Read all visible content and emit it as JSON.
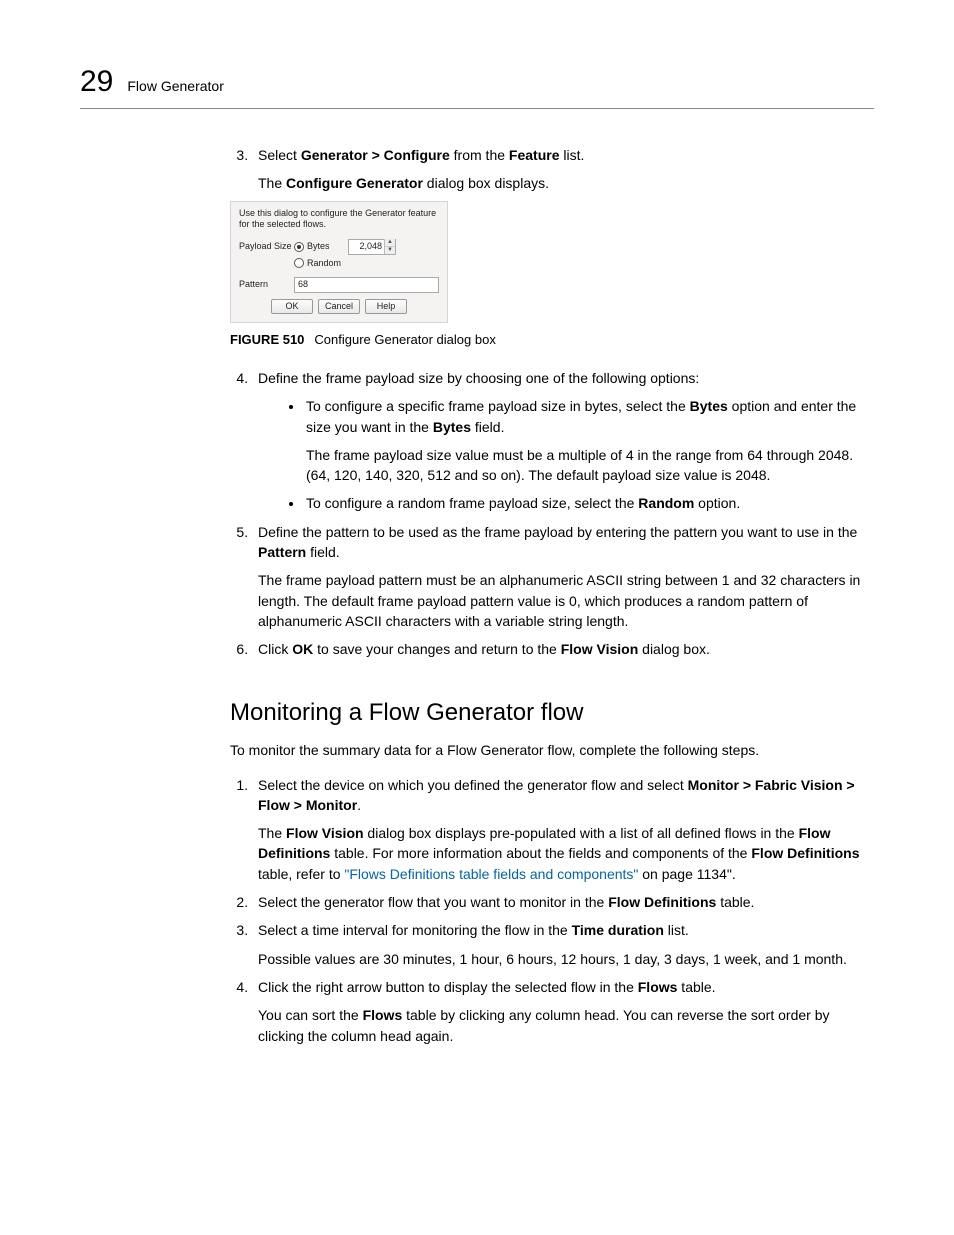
{
  "header": {
    "chapter_number": "29",
    "chapter_title": "Flow Generator"
  },
  "step3": {
    "num": "3.",
    "pre": "Select ",
    "menu": "Generator > Configure",
    "mid": " from the ",
    "feature": "Feature",
    "post": " list.",
    "sub_pre": "The ",
    "sub_bold": "Configure Generator",
    "sub_post": " dialog box displays."
  },
  "dialog": {
    "desc": "Use this dialog to configure the Generator feature for the selected flows.",
    "payload_label": "Payload Size",
    "bytes_label": "Bytes",
    "bytes_value": "2,048",
    "random_label": "Random",
    "pattern_label": "Pattern",
    "pattern_value": "68",
    "ok": "OK",
    "cancel": "Cancel",
    "help": "Help"
  },
  "figure": {
    "label": "FIGURE 510",
    "caption": "Configure Generator dialog box"
  },
  "step4": {
    "text": "Define the frame payload size by choosing one of the following options:",
    "b1_pre": "To configure a specific frame payload size in bytes, select the ",
    "b1_bytes": "Bytes",
    "b1_mid": " option and enter the size you want in the ",
    "b1_bytes2": "Bytes",
    "b1_post": " field.",
    "b1_para": "The frame payload size value must be a multiple of 4 in the range from 64 through 2048. (64, 120, 140, 320, 512 and so on). The default payload size value is 2048.",
    "b2_pre": "To configure a random frame payload size, select the ",
    "b2_random": "Random",
    "b2_post": " option."
  },
  "step5": {
    "pre": "Define the pattern to be used as the frame payload by entering the pattern you want to use in the ",
    "pattern": "Pattern",
    "post": " field.",
    "para": "The frame payload pattern must be an alphanumeric ASCII string between 1 and 32 characters in length. The default frame payload pattern value is 0, which produces a random pattern of alphanumeric ASCII characters with a variable string length."
  },
  "step6": {
    "pre": "Click ",
    "ok": "OK",
    "mid": " to save your changes and return to the ",
    "fv": "Flow Vision",
    "post": " dialog box."
  },
  "section2": {
    "heading": "Monitoring a Flow Generator flow",
    "intro": "To monitor the summary data for a Flow Generator flow, complete the following steps."
  },
  "m1": {
    "pre": "Select the device on which you defined the generator flow and select ",
    "menu": "Monitor > Fabric Vision > Flow > Monitor",
    "post": ".",
    "p_pre": "The ",
    "p_fv": "Flow Vision",
    "p_mid": " dialog box displays pre-populated with a list of all defined flows in the ",
    "p_fd1": "Flow Definitions",
    "p_mid2": " table. For more information about the fields and components of the ",
    "p_fd2": "Flow Definitions",
    "p_mid3": " table, refer to ",
    "p_link": "\"Flows Definitions table fields and components\"",
    "p_post": " on page 1134\"."
  },
  "m2": {
    "pre": "Select the generator flow that you want to monitor in the ",
    "fd": "Flow Definitions",
    "post": " table."
  },
  "m3": {
    "pre": "Select a time interval for monitoring the flow in the ",
    "td": "Time duration",
    "post": " list.",
    "para": "Possible values are 30 minutes, 1 hour, 6 hours, 12 hours, 1 day, 3 days, 1 week, and 1 month."
  },
  "m4": {
    "pre": "Click the right arrow button to display the selected flow in the ",
    "flows": "Flows",
    "post": " table.",
    "p_pre": "You can sort the ",
    "p_flows": "Flows",
    "p_post": " table by clicking any column head. You can reverse the sort order by clicking the column head again."
  }
}
